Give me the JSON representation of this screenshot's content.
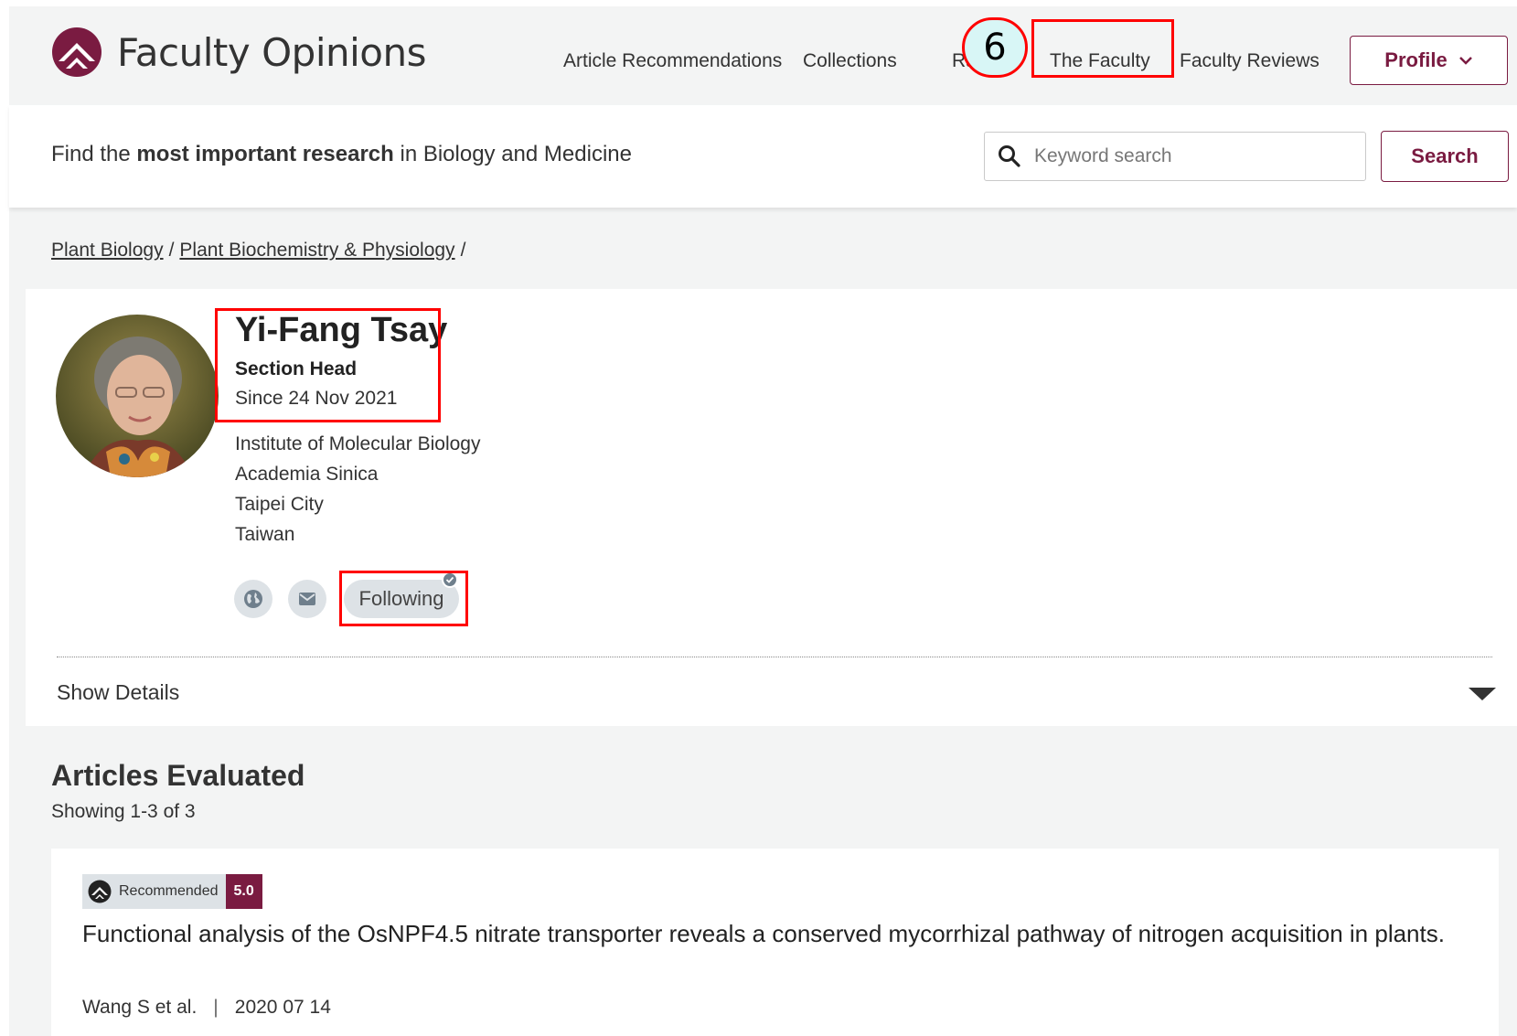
{
  "brand": {
    "name": "Faculty Opinions",
    "accent_color": "#7a1b41"
  },
  "nav": {
    "items": [
      "Article Recommendations",
      "Collections",
      "Ra",
      "The Faculty",
      "Faculty Reviews"
    ],
    "profile_label": "Profile"
  },
  "search": {
    "tagline_pre": "Find the ",
    "tagline_bold": "most important research",
    "tagline_post": " in Biology and Medicine",
    "placeholder": "Keyword search",
    "button_label": "Search"
  },
  "breadcrumb": {
    "items": [
      "Plant Biology",
      "Plant Biochemistry & Physiology"
    ],
    "separator": "/"
  },
  "person": {
    "name": "Yi-Fang Tsay",
    "role": "Section Head",
    "since": "Since 24 Nov 2021",
    "affiliation": [
      "Institute of Molecular Biology",
      "Academia Sinica",
      "Taipei City",
      "Taiwan"
    ],
    "follow_label": "Following",
    "show_details_label": "Show Details"
  },
  "articles": {
    "title": "Articles Evaluated",
    "showing": "Showing 1-3 of 3",
    "items": [
      {
        "badge_label": "Recommended",
        "score": "5.0",
        "title": "Functional analysis of the OsNPF4.5 nitrate transporter reveals a conserved mycorrhizal pathway of nitrogen acquisition in plants.",
        "authors": "Wang S et al.",
        "date": "2020 07 14"
      }
    ]
  },
  "annotation": {
    "step": "6",
    "highlight_color": "#ff0000"
  }
}
